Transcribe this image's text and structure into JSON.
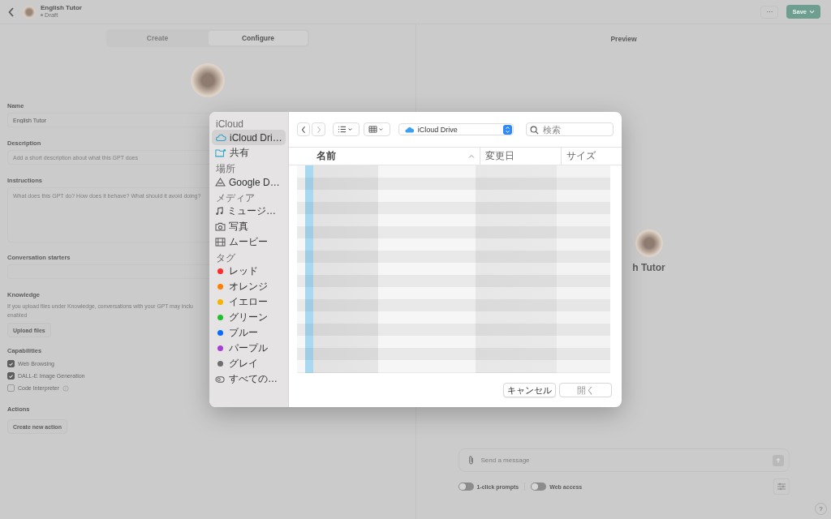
{
  "header": {
    "title": "English Tutor",
    "status": "Draft",
    "more_button": "···",
    "save_button": "Save"
  },
  "tabs": [
    {
      "label": "Create",
      "selected": false
    },
    {
      "label": "Configure",
      "selected": true
    }
  ],
  "form": {
    "name": {
      "label": "Name",
      "value": "English Tutor"
    },
    "description": {
      "label": "Description",
      "placeholder": "Add a short description about what this GPT does"
    },
    "instructions": {
      "label": "Instructions",
      "placeholder": "What does this GPT do? How does it behave? What should it avoid doing?"
    },
    "conversation_starters": {
      "label": "Conversation starters"
    },
    "knowledge": {
      "label": "Knowledge",
      "text_lines": [
        "If you upload files under Knowledge, conversations with your GPT may inclu",
        "enabled"
      ],
      "upload_button": "Upload files"
    },
    "capabilities": {
      "label": "Capabilities",
      "items": [
        {
          "label": "Web Browsing",
          "checked": true,
          "info": false
        },
        {
          "label": "DALL-E Image Generation",
          "checked": true,
          "info": false
        },
        {
          "label": "Code Interpreter",
          "checked": false,
          "info": true
        }
      ]
    },
    "actions": {
      "label": "Actions",
      "button": "Create new action"
    }
  },
  "preview": {
    "title": "Preview",
    "name": "h Tutor",
    "message_placeholder": "Send a message",
    "toggles": [
      {
        "label": "1-click prompts",
        "on": false
      },
      {
        "label": "Web access",
        "on": false
      }
    ],
    "help": "?"
  },
  "file_dialog": {
    "sidebar": [
      {
        "heading": "iCloud",
        "items": [
          {
            "label": "iCloud Dri…",
            "selected": true
          },
          {
            "label": "共有",
            "selected": false
          }
        ]
      },
      {
        "heading": "場所",
        "items": [
          {
            "label": "Google D…",
            "selected": false
          }
        ]
      },
      {
        "heading": "メディア",
        "items": [
          {
            "label": "ミュージ…",
            "selected": false
          },
          {
            "label": "写真",
            "selected": false
          },
          {
            "label": "ムービー",
            "selected": false
          }
        ]
      },
      {
        "heading": "タグ",
        "items": [
          {
            "label": "レッド",
            "color": "#ff2a2a",
            "selected": false
          },
          {
            "label": "オレンジ",
            "color": "#ff8000",
            "selected": false
          },
          {
            "label": "イエロー",
            "color": "#f5b400",
            "selected": false
          },
          {
            "label": "グリーン",
            "color": "#1fbf2f",
            "selected": false
          },
          {
            "label": "ブルー",
            "color": "#0a6cff",
            "selected": false
          },
          {
            "label": "パープル",
            "color": "#a83ed6",
            "selected": false
          },
          {
            "label": "グレイ",
            "color": "#6e6e6e",
            "selected": false
          },
          {
            "label": "すべての…",
            "selected": false
          }
        ]
      }
    ],
    "location": "iCloud Drive",
    "search_placeholder": "検索",
    "columns": [
      {
        "label": "名前",
        "sorted": true
      },
      {
        "label": "変更日",
        "sorted": false
      },
      {
        "label": "サイズ",
        "sorted": false
      }
    ],
    "buttons": [
      {
        "label": "キャンセル",
        "disabled": false
      },
      {
        "label": "開く",
        "disabled": true
      }
    ]
  }
}
